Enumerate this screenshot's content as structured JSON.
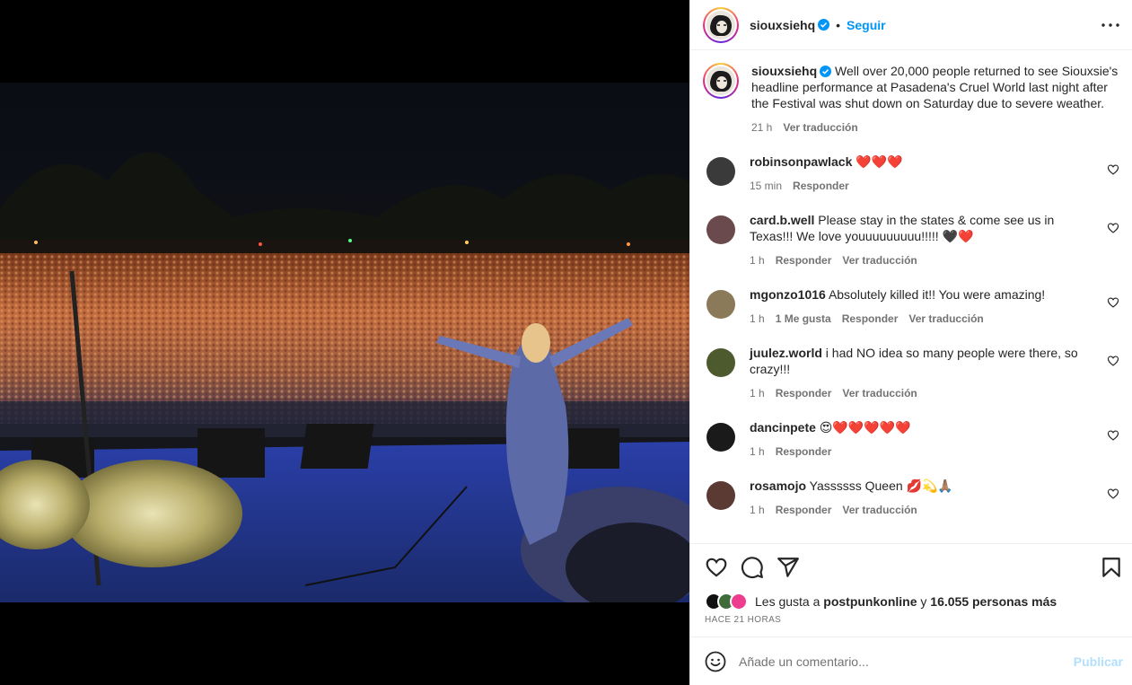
{
  "post": {
    "username": "siouxsiehq",
    "follow_label": "Seguir",
    "separator": "•",
    "caption": "Well over 20,000 people returned to see Siouxsie's headline performance at Pasadena's Cruel World last night after the Festival was shut down on Saturday due to severe weather.",
    "caption_time": "21 h",
    "caption_translate": "Ver traducción"
  },
  "comments": [
    {
      "user": "robinsonpawlack",
      "text": "❤️❤️❤️",
      "time": "15 min",
      "likes": "",
      "reply": "Responder",
      "translate": "",
      "avatar_color": "#3a3a3a"
    },
    {
      "user": "card.b.well",
      "text": "Please stay in the states & come see us in Texas!!! We love youuuuuuuuu!!!!! 🖤❤️",
      "time": "1 h",
      "likes": "",
      "reply": "Responder",
      "translate": "Ver traducción",
      "avatar_color": "#6b4a4e"
    },
    {
      "user": "mgonzo1016",
      "text": "Absolutely killed it!! You were amazing!",
      "time": "1 h",
      "likes": "1 Me gusta",
      "reply": "Responder",
      "translate": "Ver traducción",
      "avatar_color": "#8a7a5a"
    },
    {
      "user": "juulez.world",
      "text": "i had NO idea so many people were there, so crazy!!!",
      "time": "1 h",
      "likes": "",
      "reply": "Responder",
      "translate": "Ver traducción",
      "avatar_color": "#4d5a2e"
    },
    {
      "user": "dancinpete",
      "text": "😍❤️❤️❤️❤️❤️",
      "time": "1 h",
      "likes": "",
      "reply": "Responder",
      "translate": "",
      "avatar_color": "#1a1a1a"
    },
    {
      "user": "rosamojo",
      "text": "Yassssss Queen 💋💫🙏🏽",
      "time": "1 h",
      "likes": "",
      "reply": "Responder",
      "translate": "Ver traducción",
      "avatar_color": "#5a3a32"
    }
  ],
  "likes": {
    "prefix": "Les gusta a",
    "user": "postpunkonline",
    "conj": "y",
    "others": "16.055 personas más"
  },
  "timestamp": "HACE 21 HORAS",
  "add_comment": {
    "placeholder": "Añade un comentario...",
    "post_label": "Publicar"
  },
  "colors": {
    "link": "#0095f6",
    "publish_disabled": "#b2dffc",
    "muted": "#737373"
  },
  "icons": [
    "verified-badge-icon",
    "more-options-icon",
    "heart-icon",
    "comment-icon",
    "share-icon",
    "save-bookmark-icon",
    "emoji-icon"
  ]
}
